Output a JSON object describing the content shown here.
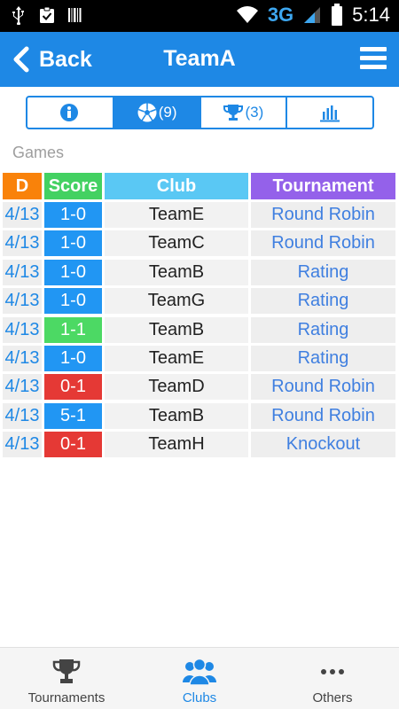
{
  "status_bar": {
    "left_icons": [
      "usb-icon",
      "clipboard-check-icon",
      "barcode-icon"
    ],
    "network": "3G",
    "time": "5:14"
  },
  "header": {
    "back_label": "Back",
    "title": "TeamA",
    "accent_color": "#1e88e5"
  },
  "tabs": [
    {
      "icon": "info-icon",
      "count": ""
    },
    {
      "icon": "soccer-ball-icon",
      "count": "(9)",
      "active": true
    },
    {
      "icon": "trophy-icon",
      "count": "(3)"
    },
    {
      "icon": "bar-chart-icon",
      "count": ""
    }
  ],
  "section_label": "Games",
  "table": {
    "headers": {
      "date": "D",
      "score": "Score",
      "club": "Club",
      "tournament": "Tournament"
    },
    "header_colors": {
      "date": "#f9820a",
      "score": "#43d162",
      "club": "#5ac8f4",
      "tournament": "#9461ea"
    },
    "rows": [
      {
        "date": "4/13",
        "score": "1-0",
        "result": "win",
        "club": "TeamE",
        "tournament": "Round Robin"
      },
      {
        "date": "4/13",
        "score": "1-0",
        "result": "win",
        "club": "TeamC",
        "tournament": "Round Robin"
      },
      {
        "date": "4/13",
        "score": "1-0",
        "result": "win",
        "club": "TeamB",
        "tournament": "Rating"
      },
      {
        "date": "4/13",
        "score": "1-0",
        "result": "win",
        "club": "TeamG",
        "tournament": "Rating"
      },
      {
        "date": "4/13",
        "score": "1-1",
        "result": "draw",
        "club": "TeamB",
        "tournament": "Rating"
      },
      {
        "date": "4/13",
        "score": "1-0",
        "result": "win",
        "club": "TeamE",
        "tournament": "Rating"
      },
      {
        "date": "4/13",
        "score": "0-1",
        "result": "loss",
        "club": "TeamD",
        "tournament": "Round Robin"
      },
      {
        "date": "4/13",
        "score": "5-1",
        "result": "win",
        "club": "TeamB",
        "tournament": "Round Robin"
      },
      {
        "date": "4/13",
        "score": "0-1",
        "result": "loss",
        "club": "TeamH",
        "tournament": "Knockout"
      }
    ],
    "result_colors": {
      "win": "#2196f3",
      "draw": "#4cd964",
      "loss": "#e53935"
    }
  },
  "bottom_nav": [
    {
      "label": "Tournaments",
      "icon": "trophy-icon"
    },
    {
      "label": "Clubs",
      "icon": "group-icon",
      "active": true
    },
    {
      "label": "Others",
      "icon": "more-dots-icon"
    }
  ]
}
